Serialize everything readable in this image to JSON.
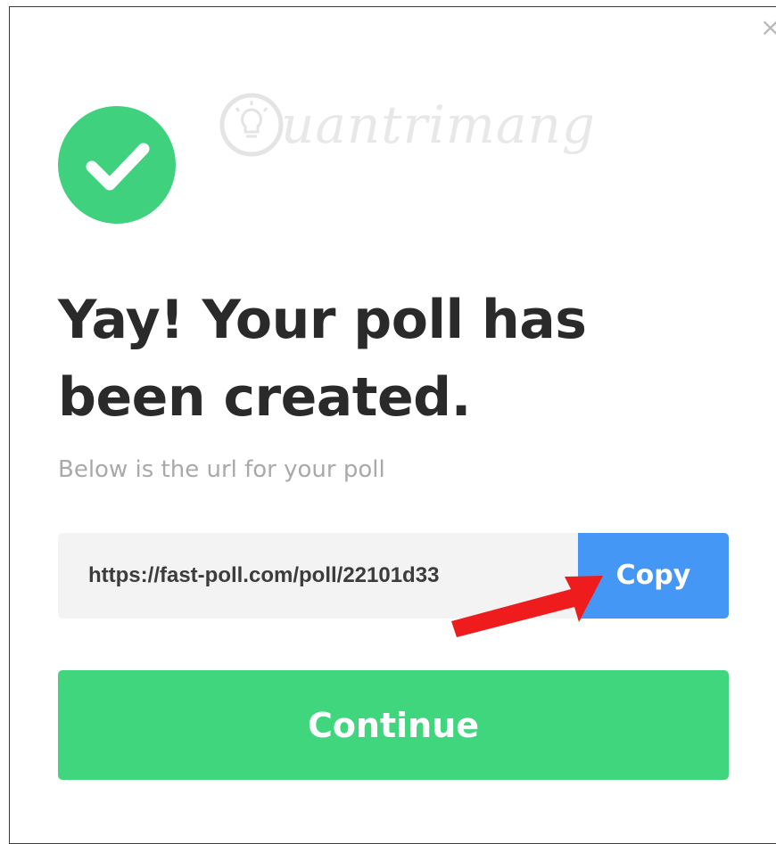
{
  "dialog": {
    "watermark_text": "uantrimang",
    "title": "Yay! Your poll has been created.",
    "subtitle": "Below is the url for your poll",
    "poll_url": "https://fast-poll.com/poll/22101d33",
    "copy_label": "Copy",
    "continue_label": "Continue"
  },
  "icons": {
    "success": "check-circle-icon",
    "close": "close-icon",
    "annotation": "red-arrow-icon",
    "watermark_logo": "lightbulb-logo-icon"
  },
  "colors": {
    "success_green": "#3fd17e",
    "continue_green": "#3fd67d",
    "copy_blue": "#4597f5",
    "url_bar_bg": "#f3f3f3",
    "title_text": "#2a2a2a",
    "subtitle_text": "#a9a9a9",
    "arrow_red": "#ee1c1c"
  }
}
